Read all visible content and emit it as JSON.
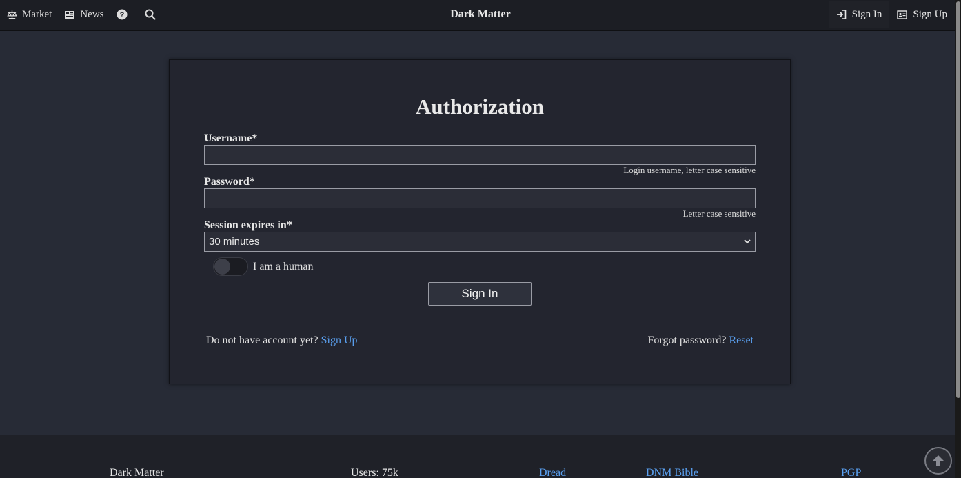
{
  "nav": {
    "market_label": "Market",
    "news_label": "News",
    "title": "Dark Matter",
    "signin_label": "Sign In",
    "signup_label": "Sign Up"
  },
  "auth": {
    "heading": "Authorization",
    "username_label": "Username*",
    "username_value": "",
    "username_hint": "Login username, letter case sensitive",
    "password_label": "Password*",
    "password_value": "",
    "password_hint": "Letter case sensitive",
    "session_label": "Session expires in*",
    "session_value": "30 minutes",
    "human_label": "I am a human",
    "submit_label": "Sign In",
    "no_account_text": "Do not have account yet?",
    "signup_link": "Sign Up",
    "forgot_text": "Forgot password?",
    "reset_link": "Reset"
  },
  "footer": {
    "site_name": "Dark Matter",
    "users": "Users: 75k",
    "links": [
      "Dread",
      "DNM Bible",
      "PGP"
    ]
  },
  "colors": {
    "background": "#272b36",
    "card": "#23252f",
    "nav": "#1c1e24",
    "link": "#5aa0f0"
  }
}
